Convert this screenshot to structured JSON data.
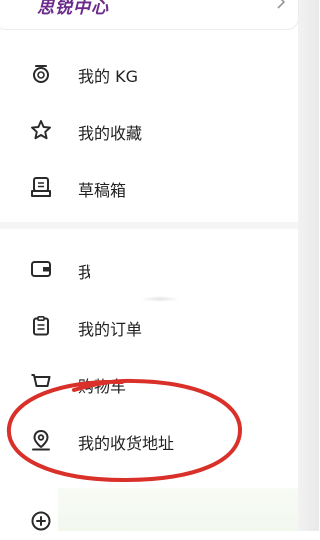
{
  "top_card": {
    "brand_text": "思锐中心"
  },
  "menu": {
    "items": [
      {
        "label": "我的 KG",
        "icon": "kg-coin-icon"
      },
      {
        "label": "我的收藏",
        "icon": "star-icon"
      },
      {
        "label": "草稿箱",
        "icon": "drafts-box-icon"
      },
      {
        "label": "我",
        "icon": "wallet-icon"
      },
      {
        "label": "我的订单",
        "icon": "clipboard-icon"
      },
      {
        "label": "购物车",
        "icon": "cart-icon"
      },
      {
        "label": "我的收货地址",
        "icon": "location-pin-icon"
      },
      {
        "label": "",
        "icon": "plus-circle-icon"
      }
    ]
  },
  "annotation": {
    "circle_color": "#d9302a"
  },
  "colors": {
    "icon": "#2a2a2a",
    "text": "#222222",
    "brand": "#6b2b8b"
  }
}
